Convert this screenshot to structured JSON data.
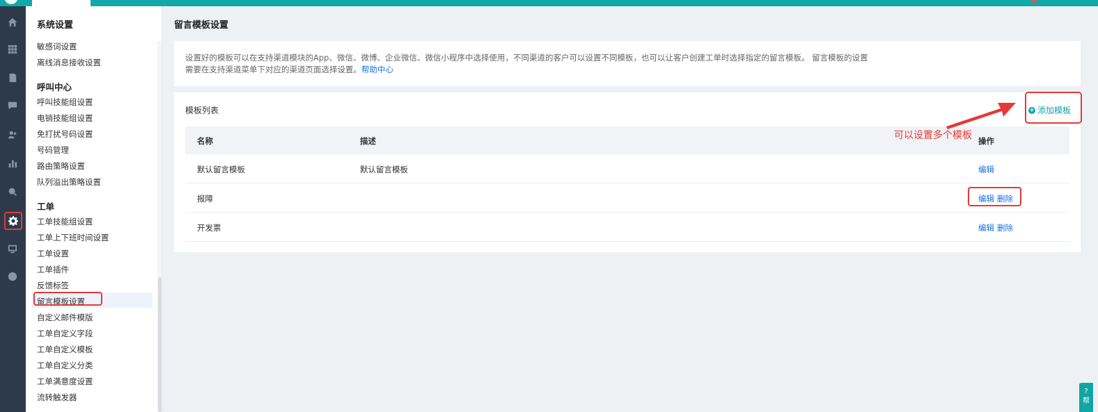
{
  "sidebar": {
    "title": "系统设置",
    "group_misc": [
      "敏感词设置",
      "离线消息接收设置"
    ],
    "group_call": {
      "heading": "呼叫中心",
      "items": [
        "呼叫技能组设置",
        "电销技能组设置",
        "免打扰号码设置",
        "号码管理",
        "路由策略设置",
        "队列溢出策略设置"
      ]
    },
    "group_ticket": {
      "heading": "工单",
      "items": [
        "工单技能组设置",
        "工单上下班时间设置",
        "工单设置",
        "工单插件",
        "反馈标签",
        "留言模板设置",
        "自定义邮件模版",
        "工单自定义字段",
        "工单自定义模板",
        "工单自定义分类",
        "工单满意度设置",
        "流转触发器"
      ]
    }
  },
  "main": {
    "page_title": "留言模板设置",
    "notice_line1": "设置好的模板可以在支持渠道模块的App、微信、微博、企业微信、微信小程序中选择使用，不同渠道的客户可以设置不同模板，也可以让客户创建工单时选择指定的留言模板。 留言模板的设置",
    "notice_line2": "需要在支持渠道菜单下对应的渠道页面选择设置。",
    "help_link": "帮助中心",
    "card_title": "模板列表",
    "add_button": "添加模板",
    "columns": {
      "name": "名称",
      "desc": "描述",
      "ops": "操作"
    },
    "rows": [
      {
        "name": "默认留言模板",
        "desc": "默认留言模板",
        "edit": "编辑",
        "delete": ""
      },
      {
        "name": "报障",
        "desc": "",
        "edit": "编辑",
        "delete": "删除"
      },
      {
        "name": "开发票",
        "desc": "",
        "edit": "编辑",
        "delete": "删除"
      }
    ],
    "annotation": "可以设置多个模板"
  },
  "help_widget": "帮",
  "colors": {
    "accent": "#12a5a5",
    "link": "#1a6fe0",
    "highlight": "#e53935",
    "rail": "#2d3a4b"
  }
}
